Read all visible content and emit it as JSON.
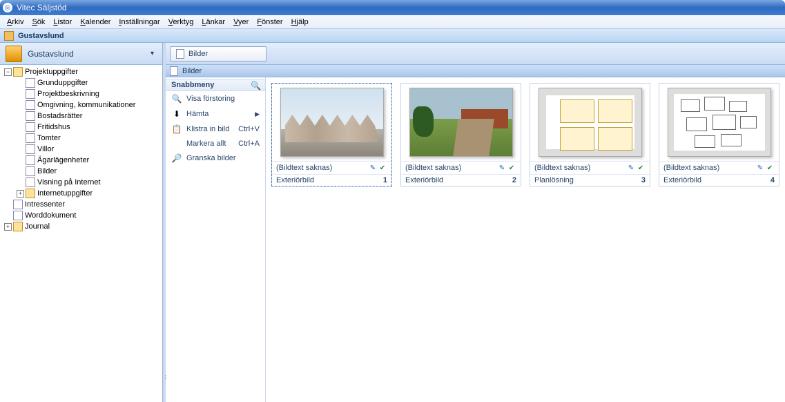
{
  "window": {
    "title": "Vitec Säljstöd"
  },
  "menu": [
    "Arkiv",
    "Sök",
    "Listor",
    "Kalender",
    "Inställningar",
    "Verktyg",
    "Länkar",
    "Vyer",
    "Fönster",
    "Hjälp"
  ],
  "docheader": {
    "title": "Gustavslund"
  },
  "leftheader": {
    "title": "Gustavslund"
  },
  "tree": [
    {
      "indent": 0,
      "toggle": "−",
      "icon": "folder",
      "label": "Projektuppgifter"
    },
    {
      "indent": 1,
      "toggle": "",
      "icon": "page",
      "label": "Grunduppgifter"
    },
    {
      "indent": 1,
      "toggle": "",
      "icon": "page",
      "label": "Projektbeskrivning"
    },
    {
      "indent": 1,
      "toggle": "",
      "icon": "page",
      "label": "Omgivning, kommunikationer"
    },
    {
      "indent": 1,
      "toggle": "",
      "icon": "page",
      "label": "Bostadsrätter"
    },
    {
      "indent": 1,
      "toggle": "",
      "icon": "page",
      "label": "Fritidshus"
    },
    {
      "indent": 1,
      "toggle": "",
      "icon": "page",
      "label": "Tomter"
    },
    {
      "indent": 1,
      "toggle": "",
      "icon": "page",
      "label": "Villor"
    },
    {
      "indent": 1,
      "toggle": "",
      "icon": "page",
      "label": "Ägarlägenheter"
    },
    {
      "indent": 1,
      "toggle": "",
      "icon": "page",
      "label": "Bilder"
    },
    {
      "indent": 1,
      "toggle": "",
      "icon": "page",
      "label": "Visning på Internet"
    },
    {
      "indent": 1,
      "toggle": "+",
      "icon": "folder",
      "label": "Internetuppgifter"
    },
    {
      "indent": 0,
      "toggle": "",
      "icon": "page",
      "label": "Intressenter"
    },
    {
      "indent": 0,
      "toggle": "",
      "icon": "page",
      "label": "Worddokument"
    },
    {
      "indent": 0,
      "toggle": "+",
      "icon": "folder",
      "label": "Journal"
    }
  ],
  "rightbar": {
    "button": "Bilder"
  },
  "subheader": {
    "title": "Bilder"
  },
  "quickmenu": {
    "title": "Snabbmeny",
    "items": [
      {
        "icon": "🔍",
        "label": "Visa förstoring",
        "shortcut": "",
        "arrow": false
      },
      {
        "icon": "⬇",
        "label": "Hämta",
        "shortcut": "",
        "arrow": true
      },
      {
        "icon": "📋",
        "label": "Klistra in bild",
        "shortcut": "Ctrl+V",
        "arrow": false
      },
      {
        "icon": "",
        "label": "Markera allt",
        "shortcut": "Ctrl+A",
        "arrow": false
      },
      {
        "icon": "🔎",
        "label": "Granska bilder",
        "shortcut": "",
        "arrow": false
      }
    ]
  },
  "thumbs": [
    {
      "caption": "(Bildtext saknas)",
      "type": "Exteriörbild",
      "num": "1",
      "kind": "street",
      "selected": true
    },
    {
      "caption": "(Bildtext saknas)",
      "type": "Exteriörbild",
      "num": "2",
      "kind": "garden",
      "selected": false
    },
    {
      "caption": "(Bildtext saknas)",
      "type": "Planlösning",
      "num": "3",
      "kind": "plan",
      "selected": false
    },
    {
      "caption": "(Bildtext saknas)",
      "type": "Exteriörbild",
      "num": "4",
      "kind": "siteplan",
      "selected": false
    }
  ]
}
